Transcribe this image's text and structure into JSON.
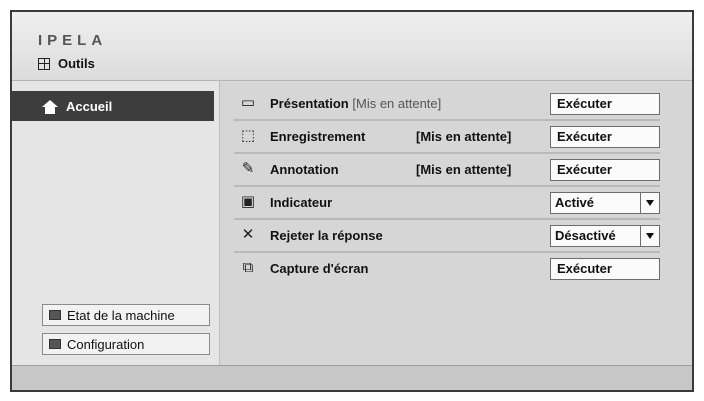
{
  "header": {
    "logo_text": "IPELA",
    "tools_label": "Outils"
  },
  "sidebar": {
    "home_label": "Accueil",
    "buttons": [
      {
        "label": "Etat de la machine"
      },
      {
        "label": "Configuration"
      }
    ]
  },
  "main": {
    "rows": [
      {
        "label": "Présentation",
        "status": "[Mis en attente]",
        "action": "Exécuter",
        "icon": "presentation-icon"
      },
      {
        "label": "Enregistrement",
        "status": "[Mis en attente]",
        "action": "Exécuter",
        "icon": "record-icon"
      },
      {
        "label": "Annotation",
        "status": "[Mis en attente]",
        "action": "Exécuter",
        "icon": "annotation-icon"
      },
      {
        "label": "Indicateur",
        "select_value": "Activé",
        "icon": "indicator-icon"
      },
      {
        "label": "Rejeter la réponse",
        "select_value": "Désactivé",
        "icon": "reject-icon"
      },
      {
        "label": "Capture d'écran",
        "action": "Exécuter",
        "icon": "screenshot-icon"
      }
    ]
  }
}
